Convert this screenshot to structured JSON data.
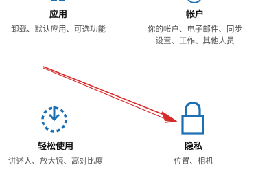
{
  "tiles": {
    "apps": {
      "title": "应用",
      "description": "卸载、默认应用、可选功能",
      "icon": "apps-icon"
    },
    "accounts": {
      "title": "帐户",
      "description_line1": "你的帐户、电子邮件、同步",
      "description_line2": "设置、工作、其他人员",
      "icon": "person-icon"
    },
    "ease_of_access": {
      "title": "轻松使用",
      "description": "讲述人、放大镜、高对比度",
      "icon": "ease-of-access-icon"
    },
    "privacy": {
      "title": "隐私",
      "description": "位置、相机",
      "icon": "lock-icon"
    }
  },
  "colors": {
    "accent": "#1a6fb5",
    "annotation_arrow": "#d62b2b"
  }
}
